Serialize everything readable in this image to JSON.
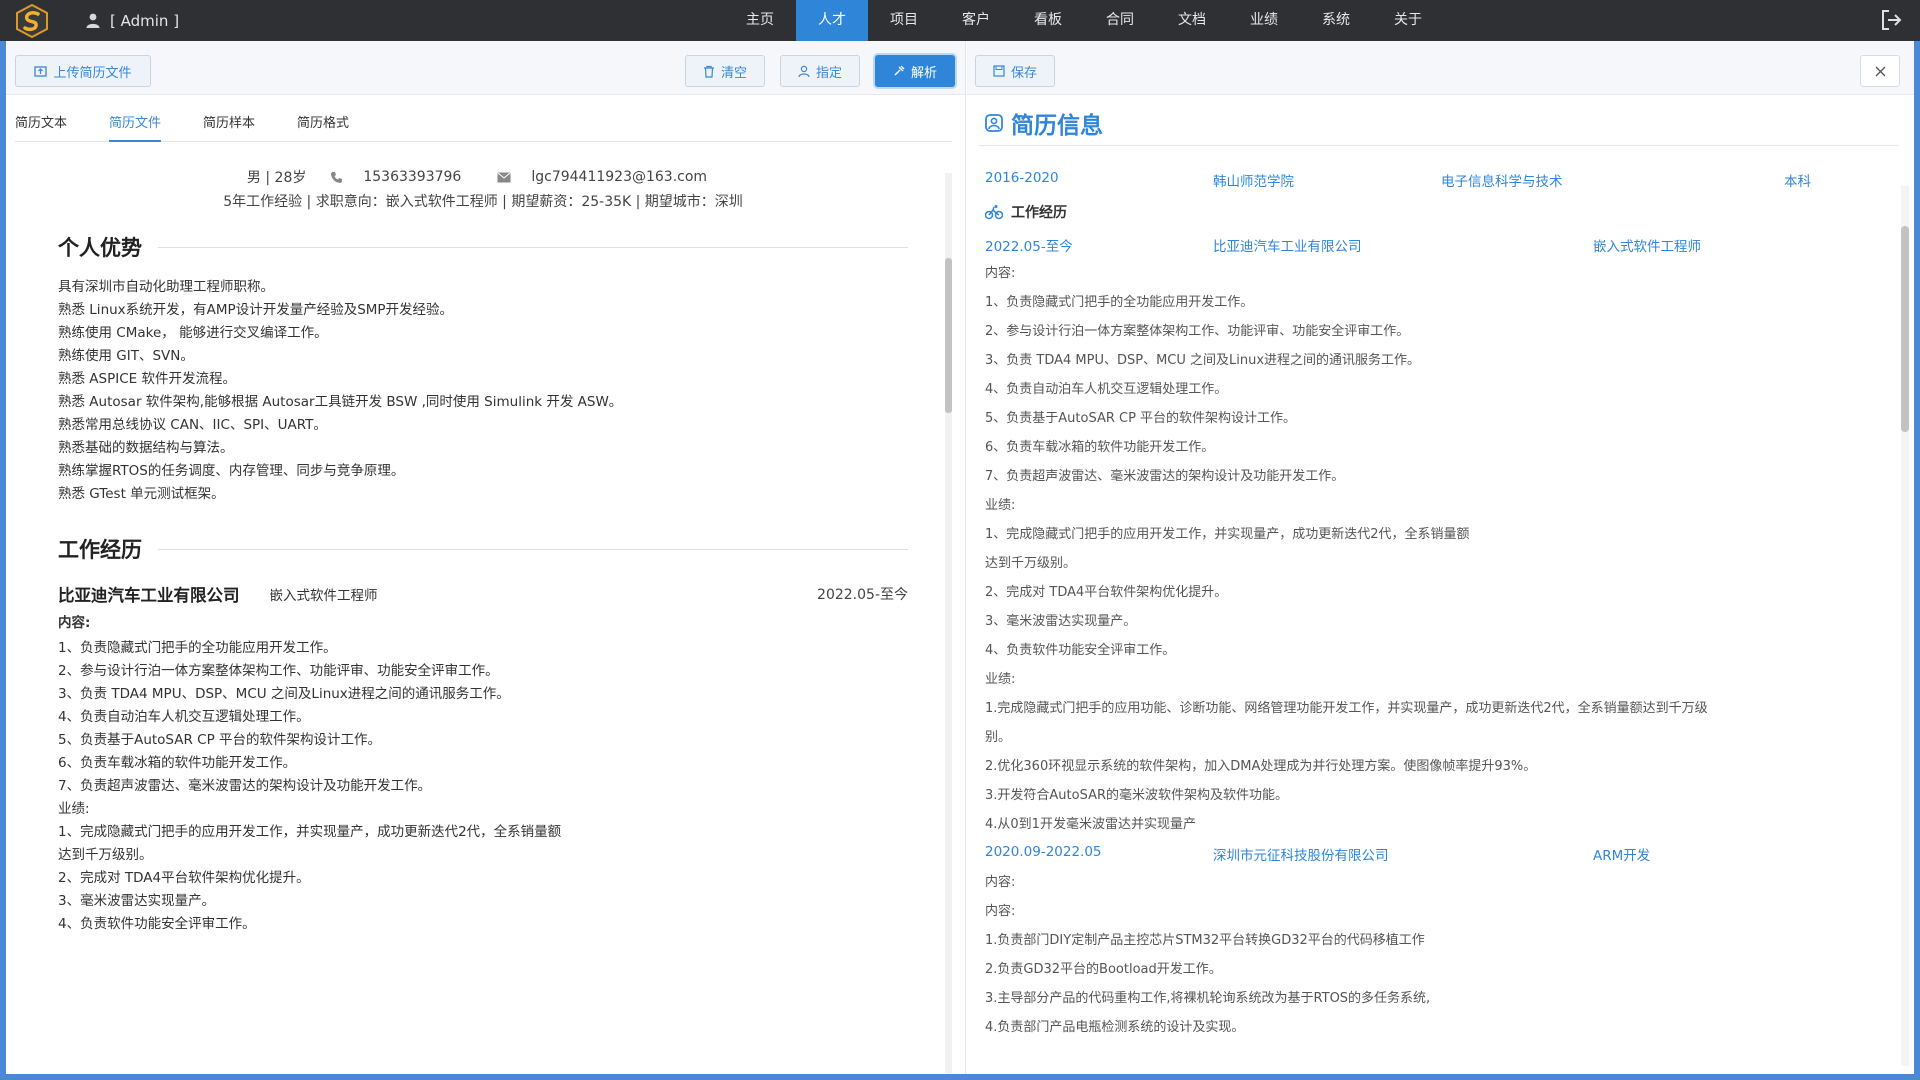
{
  "app": {
    "user": "[ Admin ]",
    "nav": [
      "主页",
      "人才",
      "项目",
      "客户",
      "看板",
      "合同",
      "文档",
      "业绩",
      "系统",
      "关于"
    ],
    "nav_active": "人才"
  },
  "left": {
    "upload_label": "上传简历文件",
    "clear_label": "清空",
    "assign_label": "指定",
    "parse_label": "解析",
    "tabs": [
      "简历文本",
      "简历文件",
      "简历样本",
      "简历格式"
    ],
    "tab_active": "简历文件",
    "doc": {
      "gender_age": "男 | 28岁",
      "phone": "15363393796",
      "email": "lgc794411923@163.com",
      "intent": "5年工作经验 | 求职意向：嵌入式软件工程师 | 期望薪资：25-35K | 期望城市：深圳",
      "advantage_title": "个人优势",
      "advantages": [
        "具有深圳市自动化助理工程师职称。",
        "熟悉 Linux系统开发，有AMP设计开发量产经验及SMP开发经验。",
        "熟练使用 CMake， 能够进行交叉编译工作。",
        "熟练使用 GIT、SVN。",
        "熟悉 ASPICE 软件开发流程。",
        "熟悉 Autosar 软件架构,能够根据 Autosar工具链开发 BSW ,同时使用 Simulink 开发 ASW。",
        "熟悉常用总线协议 CAN、IIC、SPI、UART。",
        "熟悉基础的数据结构与算法。",
        "熟练掌握RTOS的任务调度、内存管理、同步与竞争原理。",
        "熟悉 GTest 单元测试框架。"
      ],
      "work_title": "工作经历",
      "job_company": "比亚迪汽车工业有限公司",
      "job_role": "嵌入式软件工程师",
      "job_date": "2022.05-至今",
      "content_label": "内容:",
      "contents": [
        "1、负责隐藏式门把手的全功能应用开发工作。",
        "2、参与设计行泊一体方案整体架构工作、功能评审、功能安全评审工作。",
        "3、负责 TDA4 MPU、DSP、MCU 之间及Linux进程之间的通讯服务工作。",
        "4、负责自动泊车人机交互逻辑处理工作。",
        "5、负责基于AutoSAR CP 平台的软件架构设计工作。",
        "6、负责车载冰箱的软件功能开发工作。",
        "7、负责超声波雷达、毫米波雷达的架构设计及功能开发工作。"
      ],
      "achieve_label": "业绩:",
      "achievements": [
        "1、完成隐藏式门把手的应用开发工作，并实现量产，成功更新迭代2代，全系销量额",
        "达到千万级别。",
        "2、完成对 TDA4平台软件架构优化提升。",
        "3、毫米波雷达实现量产。",
        "4、负责软件功能安全评审工作。"
      ]
    }
  },
  "right": {
    "save_label": "保存",
    "title": "简历信息",
    "education": {
      "period": "2016-2020",
      "school": "韩山师范学院",
      "major": "电子信息科学与技术",
      "degree": "本科"
    },
    "work_title": "工作经历",
    "job1": {
      "period": "2022.05-至今",
      "company": "比亚迪汽车工业有限公司",
      "role": "嵌入式软件工程师"
    },
    "job1_lines": [
      "内容:",
      "1、负责隐藏式门把手的全功能应用开发工作。",
      "2、参与设计行泊一体方案整体架构工作、功能评审、功能安全评审工作。",
      "3、负责 TDA4 MPU、DSP、MCU 之间及Linux进程之间的通讯服务工作。",
      "4、负责自动泊车人机交互逻辑处理工作。",
      "5、负责基于AutoSAR CP 平台的软件架构设计工作。",
      "6、负责车载冰箱的软件功能开发工作。",
      "7、负责超声波雷达、毫米波雷达的架构设计及功能开发工作。",
      "业绩:",
      "1、完成隐藏式门把手的应用开发工作，并实现量产，成功更新迭代2代，全系销量额",
      "达到千万级别。",
      "2、完成对 TDA4平台软件架构优化提升。",
      "3、毫米波雷达实现量产。",
      "4、负责软件功能安全评审工作。",
      "业绩:",
      "1.完成隐藏式门把手的应用功能、诊断功能、网络管理功能开发工作，并实现量产，成功更新迭代2代，全系销量额达到千万级",
      "别。",
      "2.优化360环视显示系统的软件架构，加入DMA处理成为并行处理方案。使图像帧率提升93%。",
      "3.开发符合AutoSAR的毫米波软件架构及软件功能。",
      "4.从0到1开发毫米波雷达并实现量产"
    ],
    "job2": {
      "period": "2020.09-2022.05",
      "company": "深圳市元征科技股份有限公司",
      "role": "ARM开发"
    },
    "job2_lines": [
      "内容:",
      "内容:",
      "1.负责部门DIY定制产品主控芯片STM32平台转换GD32平台的代码移植工作",
      "2.负责GD32平台的Bootload开发工作。",
      "3.主导部分产品的代码重构工作,将裸机轮询系统改为基于RTOS的多任务系统,",
      "4.负责部门产品电瓶检测系统的设计及实现。"
    ]
  }
}
